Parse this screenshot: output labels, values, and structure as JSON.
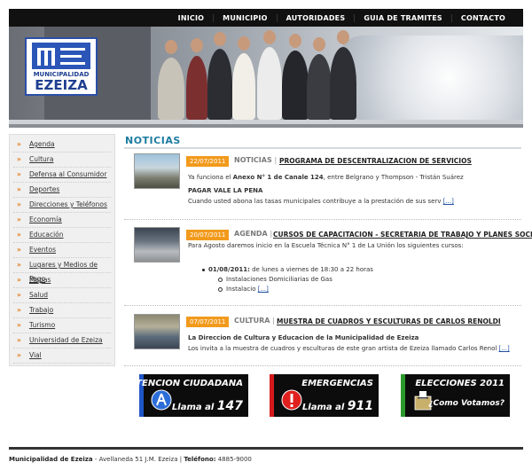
{
  "topnav": [
    "INICIO",
    "MUNICIPIO",
    "AUTORIDADES",
    "GUIA DE TRAMITES",
    "CONTACTO"
  ],
  "logo": {
    "line1": "MUNICIPALIDAD",
    "line2": "EZEIZA"
  },
  "sidebar": [
    "Agenda",
    "Cultura",
    "Defensa al Consumidor",
    "Deportes",
    "Direcciones y Teléfonos",
    "Economía",
    "Educación",
    "Eventos",
    "Lugares y Medios de Pago",
    "Mapas",
    "Salud",
    "Trabajo",
    "Turismo",
    "Universidad de Ezeiza",
    "Vial"
  ],
  "section_title": "NOTICIAS",
  "news": [
    {
      "date": "22/07/2011",
      "category": "NOTICIAS",
      "headline": "PROGRAMA DE DESCENTRALIZACION DE SERVICIOS",
      "line1_pre": "Ya funciona el ",
      "line1_bold": "Anexo N° 1 de Canale 124",
      "line1_post": ", entre Belgrano y Thompson - Tristán Suárez",
      "line2": "PAGAR VALE LA PENA",
      "line3": "Cuando usted abona las tasas municipales contribuye a la prestación de sus serv",
      "more": "[...]"
    },
    {
      "date": "20/07/2011",
      "category": "AGENDA",
      "headline": "CURSOS DE CAPACITACION - SECRETARIA DE TRABAJO Y PLANES SOCIALES",
      "line1": "Para Agosto daremos inicio en la Escuela Técnica N° 1 de La Unión los siguientes cursos:",
      "bullet_bold": "01/08/2011:",
      "bullet_text": " de lunes a viernes de 18:30 a 22 horas",
      "sub1": "Instalaciones Domiciliarias de Gas",
      "sub2": "Instalacio",
      "more": "[...]"
    },
    {
      "date": "07/07/2011",
      "category": "CULTURA",
      "headline": "MUESTRA DE CUADROS Y ESCULTURAS DE CARLOS RENOLDI",
      "line1": "La Direccion de Cultura y Educacion de la Municipalidad de Ezeiza",
      "line2": "Los invita a la muestra de cuadros y esculturas de este gran artista de Ezeiza llamado Carlos Renol",
      "more": "[...]"
    }
  ],
  "buttons": [
    {
      "title": "ATENCION CIUDADANA",
      "sub": "Llama al ",
      "num": "147",
      "color": "#1f56c8",
      "icon": "phone-icon"
    },
    {
      "title": "EMERGENCIAS",
      "sub": "Llama al ",
      "num": "911",
      "color": "#d41a1a",
      "icon": "alert-icon"
    },
    {
      "title": "ELECCIONES 2011",
      "sub": "¿Como Votamos?",
      "num": "",
      "color": "#2a9a2a",
      "icon": "ballot-box-icon"
    }
  ],
  "footer": {
    "name": "Municipalidad de Ezeiza",
    "address": " - Avellaneda 51 J.M. Ezeiza | ",
    "tel_label": "Teléfono:",
    "tel": " 4885-9000"
  }
}
